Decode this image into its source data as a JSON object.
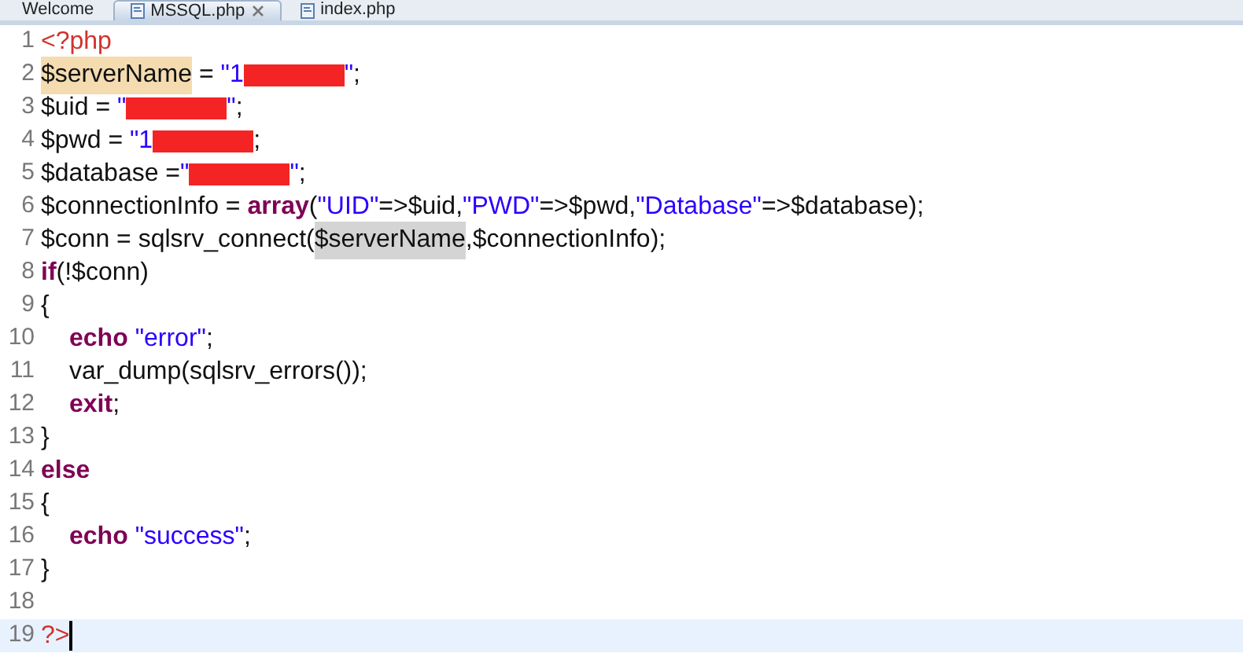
{
  "tabs": [
    {
      "label": "Welcome",
      "selected": false,
      "icon": false,
      "closable": false
    },
    {
      "label": "MSSQL.php",
      "selected": true,
      "icon": true,
      "closable": true
    },
    {
      "label": "index.php",
      "selected": false,
      "icon": true,
      "closable": false
    }
  ],
  "editor": {
    "lines": [
      {
        "number": "1",
        "tokens": [
          {
            "kind": "tag",
            "text": "<?php"
          }
        ]
      },
      {
        "number": "2",
        "tokens": [
          {
            "kind": "plain",
            "text": "$serverName",
            "color": "#f4dcb0"
          },
          {
            "kind": "plain",
            "text": " = "
          },
          {
            "kind": "string",
            "text": "\"1"
          },
          {
            "kind": "redacted"
          },
          {
            "kind": "string",
            "text": "\""
          },
          {
            "kind": "plain",
            "text": ";"
          }
        ]
      },
      {
        "number": "3",
        "tokens": [
          {
            "kind": "plain",
            "text": "$uid = "
          },
          {
            "kind": "string",
            "text": "\""
          },
          {
            "kind": "redacted"
          },
          {
            "kind": "string",
            "text": "\""
          },
          {
            "kind": "plain",
            "text": ";"
          }
        ]
      },
      {
        "number": "4",
        "tokens": [
          {
            "kind": "plain",
            "text": "$pwd = "
          },
          {
            "kind": "string",
            "text": "\"1"
          },
          {
            "kind": "redacted"
          },
          {
            "kind": "plain",
            "text": ";"
          }
        ]
      },
      {
        "number": "5",
        "tokens": [
          {
            "kind": "plain",
            "text": "$database ="
          },
          {
            "kind": "string",
            "text": "\""
          },
          {
            "kind": "redacted"
          },
          {
            "kind": "string",
            "text": "\""
          },
          {
            "kind": "plain",
            "text": ";"
          }
        ]
      },
      {
        "number": "6",
        "tokens": [
          {
            "kind": "plain",
            "text": "$connectionInfo = "
          },
          {
            "kind": "keyword",
            "text": "array"
          },
          {
            "kind": "plain",
            "text": "("
          },
          {
            "kind": "string",
            "text": "\"UID\""
          },
          {
            "kind": "plain",
            "text": "=>$uid,"
          },
          {
            "kind": "string",
            "text": "\"PWD\""
          },
          {
            "kind": "plain",
            "text": "=>$pwd,"
          },
          {
            "kind": "string",
            "text": "\"Database\""
          },
          {
            "kind": "plain",
            "text": "=>$database);"
          }
        ]
      },
      {
        "number": "7",
        "tokens": [
          {
            "kind": "plain",
            "text": "$conn = sqlsrv_connect("
          },
          {
            "kind": "plain",
            "text": "$serverName",
            "color": "#d4d4d4"
          },
          {
            "kind": "plain",
            "text": ",$connectionInfo);"
          }
        ]
      },
      {
        "number": "8",
        "tokens": [
          {
            "kind": "keyword",
            "text": "if"
          },
          {
            "kind": "plain",
            "text": "(!$conn)"
          }
        ]
      },
      {
        "number": "9",
        "tokens": [
          {
            "kind": "plain",
            "text": "{"
          }
        ]
      },
      {
        "number": "10",
        "indented": true,
        "tokens": [
          {
            "kind": "keyword",
            "text": "echo"
          },
          {
            "kind": "string",
            "text": "\"error\""
          },
          {
            "kind": "plain",
            "text": ";"
          }
        ]
      },
      {
        "number": "11",
        "indented": true,
        "tokens": [
          {
            "kind": "plain",
            "text": "var_dump(sqlsrv_errors());"
          }
        ]
      },
      {
        "number": "12",
        "indented": true,
        "tokens": [
          {
            "kind": "keyword",
            "text": "exit"
          },
          {
            "kind": "plain",
            "text": ";"
          }
        ]
      },
      {
        "number": "13",
        "tokens": [
          {
            "kind": "plain",
            "text": "}"
          }
        ]
      },
      {
        "number": "14",
        "tokens": [
          {
            "kind": "keyword",
            "text": "else"
          }
        ]
      },
      {
        "number": "15",
        "tokens": [
          {
            "kind": "plain",
            "text": "{"
          }
        ]
      },
      {
        "number": "16",
        "indented": true,
        "tokens": [
          {
            "kind": "keyword",
            "text": "echo"
          },
          {
            "kind": "string",
            "text": "\"success\""
          },
          {
            "kind": "plain",
            "text": ";"
          }
        ]
      },
      {
        "number": "17",
        "tokens": [
          {
            "kind": "plain",
            "text": "}"
          }
        ]
      },
      {
        "number": "18"
      },
      {
        "number": "19",
        "current": true,
        "caret": true,
        "tokens": [
          {
            "kind": "tag",
            "text": "?>"
          }
        ]
      }
    ]
  }
}
